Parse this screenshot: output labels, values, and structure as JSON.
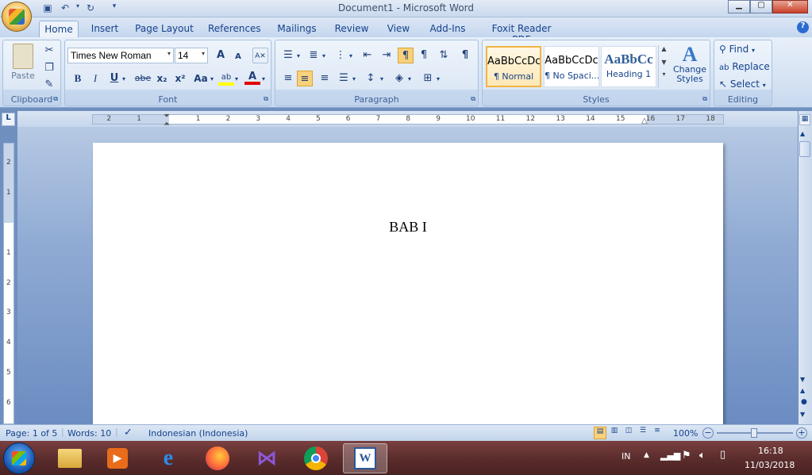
{
  "window": {
    "title": "Document1 - Microsoft Word"
  },
  "tabs": [
    "Home",
    "Insert",
    "Page Layout",
    "References",
    "Mailings",
    "Review",
    "View",
    "Add-Ins",
    "Foxit Reader PDF"
  ],
  "ribbon": {
    "clipboard": {
      "label": "Clipboard",
      "paste": "Paste"
    },
    "font": {
      "label": "Font",
      "family": "Times New Roman",
      "size": "14",
      "bold": "B",
      "italic": "I",
      "underline": "U",
      "strike": "abe",
      "subscript": "x₂",
      "superscript": "x²",
      "change_case": "Aa",
      "grow": "A",
      "shrink": "A",
      "font_color": "A"
    },
    "paragraph": {
      "label": "Paragraph"
    },
    "styles": {
      "label": "Styles",
      "items": [
        {
          "sample": "AaBbCcDc",
          "name": "¶ Normal"
        },
        {
          "sample": "AaBbCcDc",
          "name": "¶ No Spaci..."
        },
        {
          "sample": "AaBbCc",
          "name": "Heading 1"
        }
      ],
      "change_styles": "Change Styles"
    },
    "editing": {
      "label": "Editing",
      "find": "Find",
      "replace": "Replace",
      "select": "Select"
    }
  },
  "ruler": {
    "h_left": [
      "2",
      "1"
    ],
    "h_right": [
      "1",
      "2",
      "3",
      "4",
      "5",
      "6",
      "7",
      "8",
      "9",
      "10",
      "11",
      "12",
      "13",
      "14",
      "15",
      "16",
      "17",
      "18"
    ],
    "v_top": [
      "2",
      "1"
    ],
    "v_body": [
      "1",
      "2",
      "3",
      "4",
      "5",
      "6"
    ]
  },
  "document": {
    "heading": "BAB I"
  },
  "status": {
    "page": "Page: 1 of 5",
    "words": "Words: 10",
    "language": "Indonesian (Indonesia)",
    "zoom": "100%"
  },
  "taskbar": {
    "lang": "IN",
    "time": "16:18",
    "date": "11/03/2018"
  },
  "colors": {
    "accent": "#15428b",
    "title_bar": "#c9d9ee",
    "taskbar": "#5c2d2d"
  }
}
